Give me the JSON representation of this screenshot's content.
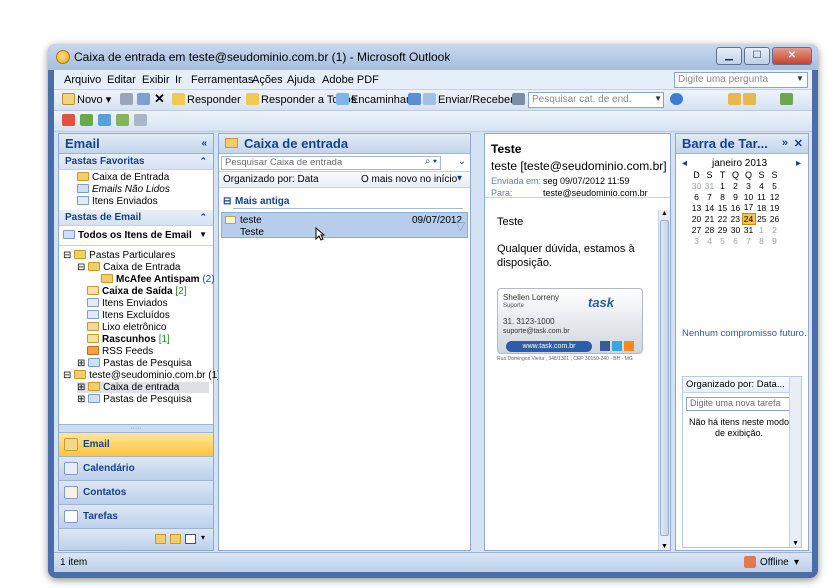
{
  "window": {
    "title": "Caixa de entrada em teste@seudominio.com.br (1) - Microsoft Outlook"
  },
  "menu": {
    "items": [
      "Arquivo",
      "Editar",
      "Exibir",
      "Ir",
      "Ferramentas",
      "Ações",
      "Ajuda",
      "Adobe PDF"
    ],
    "ask_placeholder": "Digite uma pergunta"
  },
  "toolbar": {
    "new": "Novo",
    "reply": "Responder",
    "reply_all": "Responder a Todos",
    "forward": "Encaminhar",
    "send_receive": "Enviar/Receber",
    "search_cat": "Pesquisar cat. de end."
  },
  "nav": {
    "title": "Email",
    "favorites_header": "Pastas Favoritas",
    "favorites": [
      "Caixa de Entrada",
      "Emails Não Lidos",
      "Itens Enviados"
    ],
    "mail_header": "Pastas de Email",
    "all_items": "Todos os Itens de Email",
    "tree": {
      "personal": "Pastas Particulares",
      "inbox": "Caixa de Entrada",
      "mcafee": "McAfee Antispam",
      "mcafee_count": "(2)",
      "outbox": "Caixa de Saída",
      "outbox_count": "[2]",
      "sent": "Itens Enviados",
      "deleted": "Itens Excluídos",
      "junk": "Lixo eletrônico",
      "drafts": "Rascunhos",
      "drafts_count": "[1]",
      "rss": "RSS Feeds",
      "search": "Pastas de Pesquisa",
      "account": "teste@seudominio.com.br (1)",
      "account_inbox": "Caixa de entrada",
      "account_search": "Pastas de Pesquisa"
    },
    "buttons": [
      "Email",
      "Calendário",
      "Contatos",
      "Tarefas"
    ]
  },
  "list": {
    "title": "Caixa de entrada",
    "search_placeholder": "Pesquisar Caixa de entrada",
    "arranged_by": "Organizado por: Data",
    "sort_order": "O mais novo no início",
    "group": "Mais antiga",
    "message": {
      "sender": "teste",
      "date": "09/07/2012",
      "subject": "Teste"
    }
  },
  "reading": {
    "subject": "Teste",
    "from": "teste [teste@seudominio.com.br]",
    "sent_label": "Enviada em:",
    "sent_value": "seg 09/07/2012 11:59",
    "to_label": "Para:",
    "to_value": "teste@seudominio.com.br",
    "body_greeting": "Teste",
    "body_text": "Qualquer dúvida, estamos à disposição.",
    "signature": {
      "name": "Shellen Lorreny",
      "role": "Suporte",
      "phone": "31. 3123-1000",
      "email": "suporte@task.com.br",
      "site": "www.task.com.br",
      "address": "Rua Domingos Vieira , 348/1301 , CEP 30150-240 - BH - MG",
      "logo": "task"
    }
  },
  "todo": {
    "title": "Barra de Tar...",
    "month": "janeiro 2013",
    "weekdays": [
      "D",
      "S",
      "T",
      "Q",
      "Q",
      "S",
      "S"
    ],
    "weeks": [
      [
        "30",
        "31",
        "1",
        "2",
        "3",
        "4",
        "5"
      ],
      [
        "6",
        "7",
        "8",
        "9",
        "10",
        "11",
        "12"
      ],
      [
        "13",
        "14",
        "15",
        "16",
        "17",
        "18",
        "19"
      ],
      [
        "20",
        "21",
        "22",
        "23",
        "24",
        "25",
        "26"
      ],
      [
        "27",
        "28",
        "29",
        "30",
        "31",
        "1",
        "2"
      ],
      [
        "3",
        "4",
        "5",
        "6",
        "7",
        "8",
        "9"
      ]
    ],
    "today": "24",
    "no_appointments": "Nenhum compromisso futuro.",
    "tasks_arranged": "Organizado por: Data...",
    "new_task_placeholder": "Digite uma nova tarefa",
    "no_items": "Não há itens neste modo de exibição."
  },
  "status": {
    "items": "1 item",
    "connection": "Offline"
  }
}
